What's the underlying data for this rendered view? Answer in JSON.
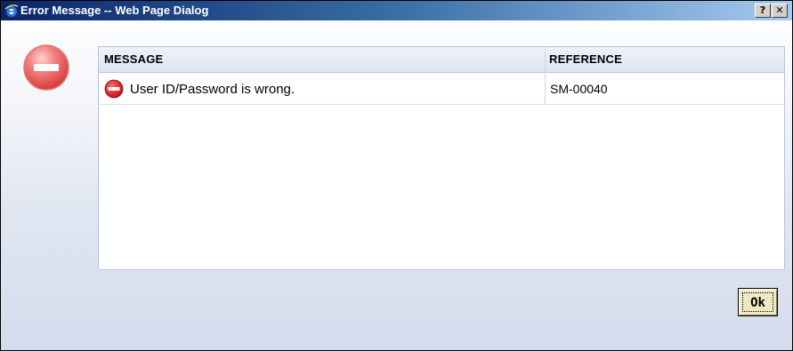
{
  "window": {
    "title": "Error Message -- Web Page Dialog",
    "help_button_label": "?",
    "close_button_label": "✕",
    "title_icon": "ie-icon"
  },
  "dialog": {
    "status_icon": "error-minus-icon",
    "colors": {
      "title_bar_start": "#0a246a",
      "title_bar_end": "#a6caf0",
      "error_red": "#d9121b",
      "ok_button": "#efe8c4"
    }
  },
  "table": {
    "columns": [
      "MESSAGE",
      "REFERENCE"
    ],
    "rows": [
      {
        "icon": "no-entry-icon",
        "message": "User ID/Password is wrong.",
        "reference": "SM-00040"
      }
    ]
  },
  "footer": {
    "ok_label": "Ok"
  }
}
